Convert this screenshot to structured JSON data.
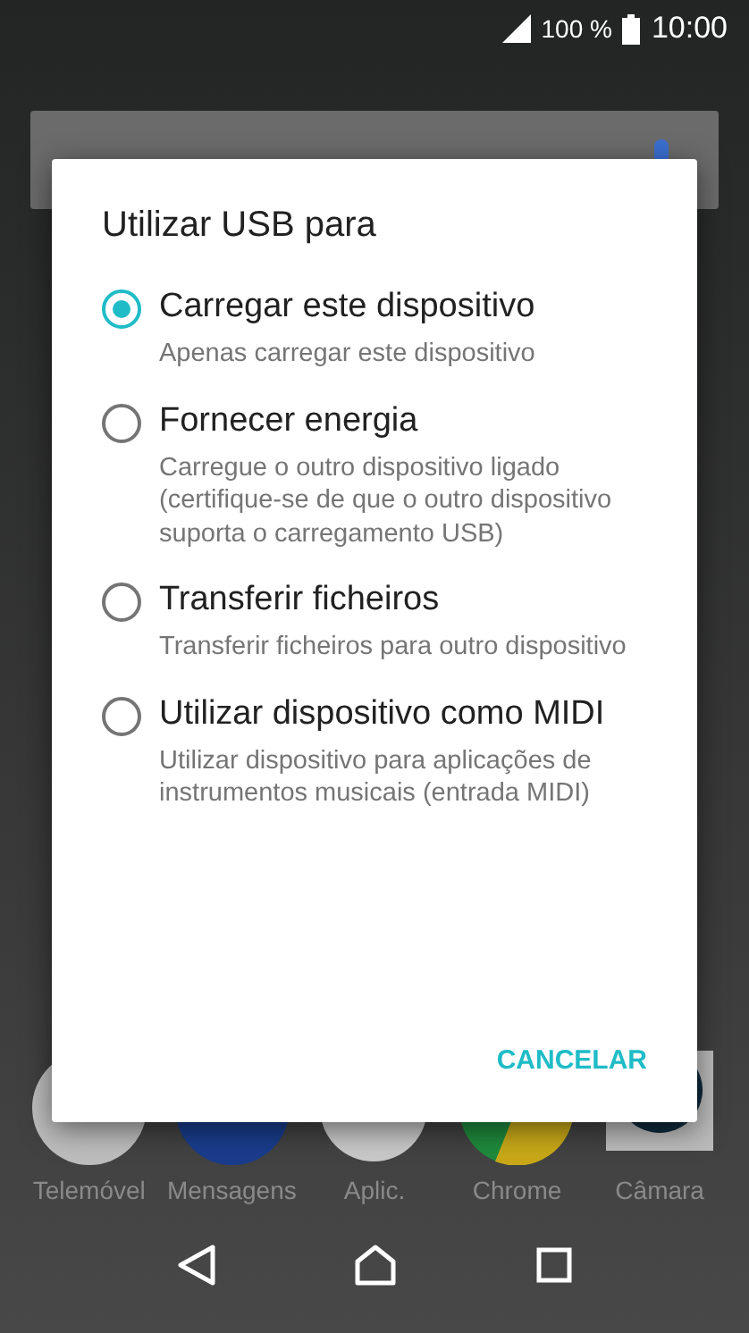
{
  "status_bar": {
    "battery_text": "100 %",
    "time": "10:00"
  },
  "dock": [
    {
      "label": "Telemóvel",
      "kind": "phone"
    },
    {
      "label": "Mensagens",
      "kind": "messages"
    },
    {
      "label": "Aplic.",
      "kind": "apps"
    },
    {
      "label": "Chrome",
      "kind": "chrome"
    },
    {
      "label": "Câmara",
      "kind": "camera"
    }
  ],
  "dialog": {
    "title": "Utilizar USB para",
    "options": [
      {
        "label": "Carregar este dispositivo",
        "description": "Apenas carregar este dispositivo",
        "selected": true
      },
      {
        "label": "Fornecer energia",
        "description": "Carregue o outro dispositivo ligado (certifique-se de que o outro dispositivo suporta o carregamento USB)",
        "selected": false
      },
      {
        "label": "Transferir ficheiros",
        "description": "Transferir ficheiros para outro dispositivo",
        "selected": false
      },
      {
        "label": "Utilizar dispositivo como MIDI",
        "description": "Utilizar dispositivo para aplicações de instrumentos musicais (entrada MIDI)",
        "selected": false
      }
    ],
    "buttons": [
      "CANCELAR"
    ]
  }
}
